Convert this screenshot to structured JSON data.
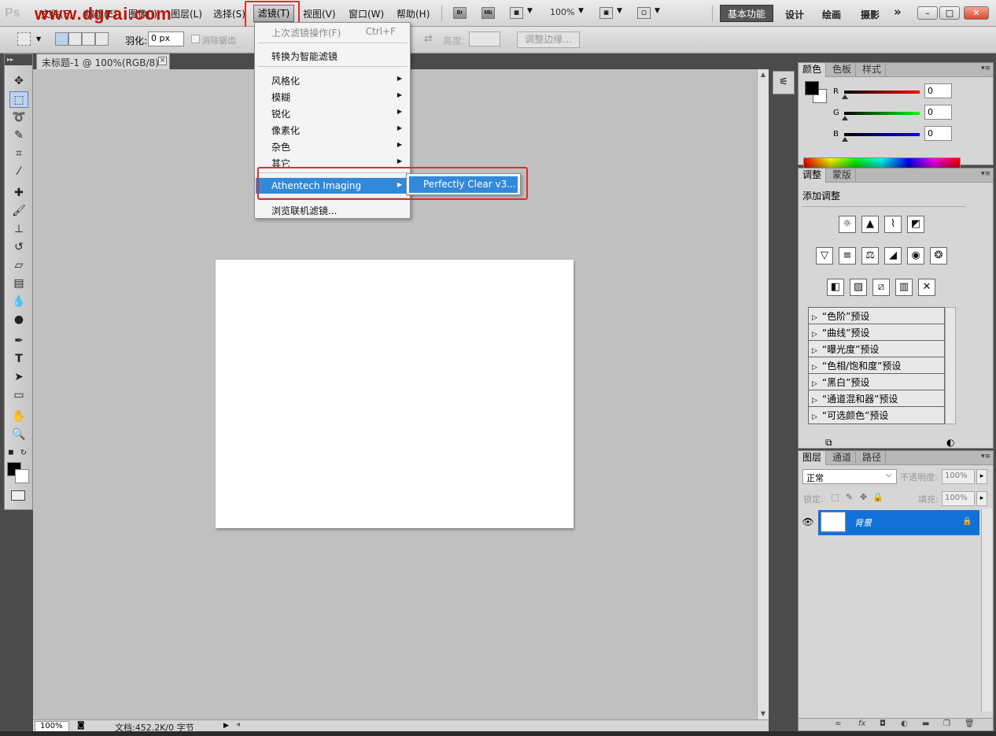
{
  "app": {
    "logo": "Ps",
    "watermark": "www.dgrai.com"
  },
  "menubar": {
    "items": [
      "文件(F)",
      "编辑(E)",
      "图像(I)",
      "图层(L)",
      "选择(S)",
      "滤镜(T)",
      "视图(V)",
      "窗口(W)",
      "帮助(H)"
    ],
    "bridge": "Br",
    "mini_bridge": "Mb",
    "zoom": "100%",
    "workspaces": [
      "基本功能",
      "设计",
      "绘画",
      "摄影"
    ],
    "more": "»"
  },
  "options_bar": {
    "feather_label": "羽化:",
    "feather_value": "0 px",
    "antialias_label": "消除锯齿",
    "height_label": "高度:",
    "refine_edge": "调整边缘..."
  },
  "document": {
    "tab_title": "未标题-1 @ 100%(RGB/8)",
    "close": "×",
    "zoom": "100%",
    "info": "文档:452.2K/0 字节"
  },
  "filter_menu": {
    "last_filter": "上次滤镜操作(F)",
    "last_filter_shortcut": "Ctrl+F",
    "smart_filters": "转换为智能滤镜",
    "stylize": "风格化",
    "blur": "模糊",
    "sharpen": "锐化",
    "pixelate": "像素化",
    "noise": "杂色",
    "other": "其它",
    "athentech": "Athentech Imaging",
    "browse_online": "浏览联机滤镜...",
    "submenu_item": "Perfectly Clear v3..."
  },
  "color_panel": {
    "tabs": [
      "颜色",
      "色板",
      "样式"
    ],
    "r_label": "R",
    "g_label": "G",
    "b_label": "B",
    "r_value": "0",
    "g_value": "0",
    "b_value": "0"
  },
  "adjustments_panel": {
    "tabs": [
      "调整",
      "蒙版"
    ],
    "title": "添加调整",
    "presets": [
      "“色阶”预设",
      "“曲线”预设",
      "“曝光度”预设",
      "“色相/饱和度”预设",
      "“黑白”预设",
      "“通道混和器”预设",
      "“可选颜色”预设"
    ]
  },
  "layers_panel": {
    "tabs": [
      "图层",
      "通道",
      "路径"
    ],
    "blend_mode": "正常",
    "opacity_label": "不透明度:",
    "opacity_value": "100%",
    "lock_label": "锁定:",
    "fill_label": "填充:",
    "fill_value": "100%",
    "layer_name": "背景"
  },
  "colors": {
    "menu_highlight": "#3289da",
    "layer_selected": "#1271d9",
    "annotation_red": "#e42a2a",
    "watermark": "#c0140c"
  }
}
